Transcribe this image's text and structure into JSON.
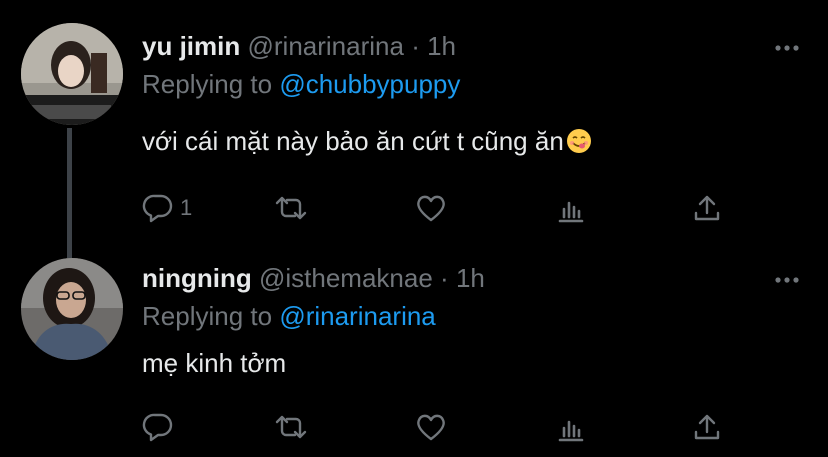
{
  "tweets": [
    {
      "name": "yu jimin",
      "handle": "@rinarinarina",
      "separator": "·",
      "time": "1h",
      "reply_prefix": "Replying to",
      "reply_to": "@chubbypuppy",
      "text": "với cái mặt này bảo ăn cứt t cũng ăn",
      "emoji": "yum-emoji",
      "actions": {
        "reply_count": "1",
        "retweet_count": "",
        "like_count": ""
      }
    },
    {
      "name": "ningning",
      "handle": "@isthemaknae",
      "separator": "·",
      "time": "1h",
      "reply_prefix": "Replying to",
      "reply_to": "@rinarinarina",
      "text": "mẹ kinh tởm",
      "actions": {
        "reply_count": "",
        "retweet_count": "",
        "like_count": ""
      }
    }
  ],
  "colors": {
    "background": "#000000",
    "text": "#e7e9ea",
    "muted": "#71767b",
    "accent": "#1d9bf0",
    "thread_line": "#3d4248"
  },
  "icons": [
    "reply-icon",
    "retweet-icon",
    "like-icon",
    "analytics-icon",
    "share-icon",
    "more-icon"
  ]
}
